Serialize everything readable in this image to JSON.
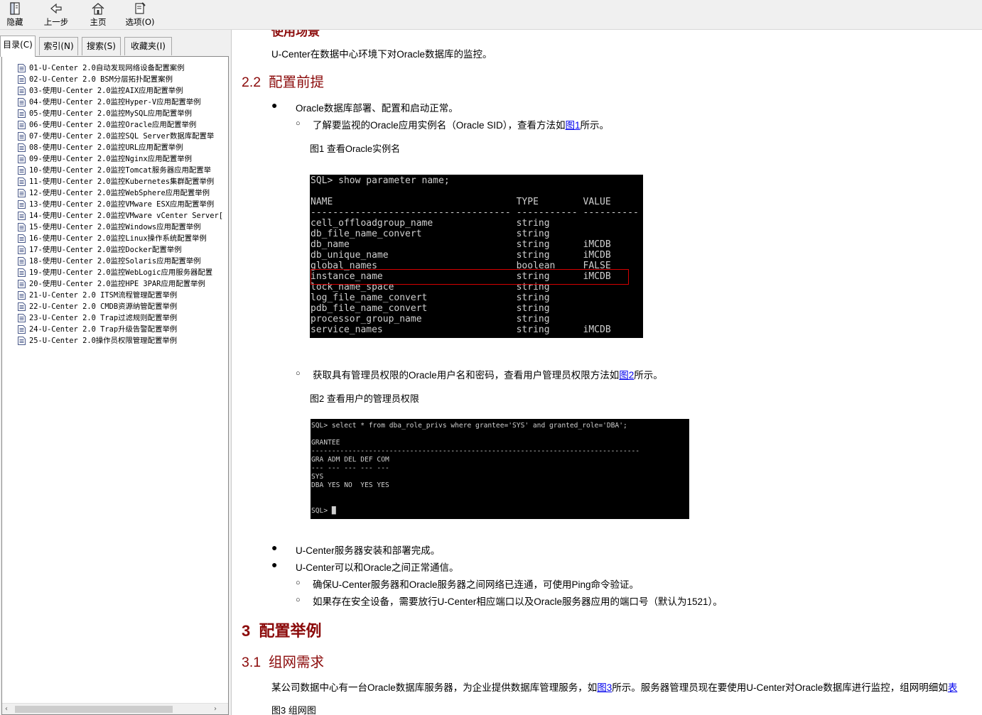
{
  "toolbar": {
    "buttons": [
      {
        "label": "隐藏",
        "icon": "hide-pane-icon"
      },
      {
        "label": "上一步",
        "icon": "back-arrow-icon"
      },
      {
        "label": "主页",
        "icon": "home-icon"
      },
      {
        "label": "选项(O)",
        "icon": "options-icon"
      }
    ]
  },
  "nav": {
    "tabs": [
      "目录(C)",
      "索引(N)",
      "搜索(S)",
      "收藏夹(I)"
    ],
    "active_tab": "目录(C)",
    "items": [
      "01-U-Center 2.0自动发现网络设备配置案例",
      "02-U-Center 2.0 BSM分层拓扑配置案例",
      "03-使用U-Center 2.0监控AIX应用配置举例",
      "04-使用U-Center 2.0监控Hyper-V应用配置举例",
      "05-使用U-Center 2.0监控MySQL应用配置举例",
      "06-使用U-Center 2.0监控Oracle应用配置举例",
      "07-使用U-Center 2.0监控SQL Server数据库配置举",
      "08-使用U-Center 2.0监控URL应用配置举例",
      "09-使用U-Center 2.0监控Nginx应用配置举例",
      "10-使用U-Center 2.0监控Tomcat服务器应用配置举",
      "11-使用U-Center 2.0监控Kubernetes集群配置举例",
      "12-使用U-Center 2.0监控WebSphere应用配置举例",
      "13-使用U-Center 2.0监控VMware ESX应用配置举例",
      "14-使用U-Center 2.0监控VMware vCenter Server[",
      "15-使用U-Center 2.0监控Windows应用配置举例",
      "16-使用U-Center 2.0监控Linux操作系统配置举例",
      "17-使用U-Center 2.0监控Docker配置举例",
      "18-使用U-Center 2.0监控Solaris应用配置举例",
      "19-使用U-Center 2.0监控WebLogic应用服务器配置",
      "20-使用U-Center 2.0监控HPE 3PAR应用配置举例",
      "21-U-Center 2.0 ITSM流程管理配置举例",
      "22-U-Center 2.0 CMDB资源纳管配置举例",
      "23-U-Center 2.0 Trap过滤规则配置举例",
      "24-U-Center 2.0 Trap升级告警配置举例",
      "25-U-Center 2.0操作员权限管理配置举例"
    ]
  },
  "content": {
    "clipped_heading": "使用场景",
    "intro": "U-Center在数据中心环境下对Oracle数据库的监控。",
    "sec22": {
      "num": "2.2",
      "title": "配置前提"
    },
    "b1": "Oracle数据库部署、配置和启动正常。",
    "b1s1_pre": "了解要监视的Oracle应用实例名（Oracle SID），查看方法如",
    "b1s1_link": "图1",
    "b1s1_post": "所示。",
    "fig1_caption": "图1 查看Oracle实例名",
    "fig1": {
      "command": "SQL> show parameter name;",
      "header": "NAME                                 TYPE        VALUE",
      "separator": "------------------------------------ ----------- ----------",
      "rows": [
        "cell_offloadgroup_name               string",
        "db_file_name_convert                 string",
        "db_name                              string      iMCDB",
        "db_unique_name                       string      iMCDB",
        "global_names                         boolean     FALSE",
        "instance_name                        string      iMCDB",
        "lock_name_space                      string",
        "log_file_name_convert                string",
        "pdb_file_name_convert                string",
        "processor_group_name                 string",
        "service_names                        string      iMCDB"
      ],
      "highlight_color": "#d40000"
    },
    "b1s2_pre": "获取具有管理员权限的Oracle用户名和密码，查看用户管理员权限方法如",
    "b1s2_link": "图2",
    "b1s2_post": "所示。",
    "fig2_caption": "图2 查看用户的管理员权限",
    "fig2": {
      "lines": [
        "SQL> select * from dba_role_privs where grantee='SYS' and granted_role='DBA';",
        "",
        "GRANTEE",
        "--------------------------------------------------------------------------------",
        "GRA ADM DEL DEF COM",
        "--- --- --- --- ---",
        "SYS",
        "DBA YES NO  YES YES",
        "",
        "",
        "SQL> █"
      ]
    },
    "b2": "U-Center服务器安装和部署完成。",
    "b3": "U-Center可以和Oracle之间正常通信。",
    "b3s1": "确保U-Center服务器和Oracle服务器之间网络已连通，可使用Ping命令验证。",
    "b3s2": "如果存在安全设备，需要放行U-Center相应端口以及Oracle服务器应用的端口号（默认为1521）。",
    "sec3": {
      "num": "3",
      "title": "配置举例"
    },
    "sec31": {
      "num": "3.1",
      "title": "组网需求"
    },
    "para31_pre": "某公司数据中心有一台Oracle数据库服务器，为企业提供数据库管理服务，如",
    "para31_link": "图3",
    "para31_post": "所示。服务器管理员现在要使用U-Center对Oracle数据库进行监控，组网明细如",
    "para31_tail_link": "表",
    "fig3_caption": "图3 组网图"
  },
  "colors": {
    "heading": "#8b0a0a",
    "link": "#0000ee",
    "terminal_bg": "#000000",
    "terminal_fg": "#cfcfcf"
  }
}
